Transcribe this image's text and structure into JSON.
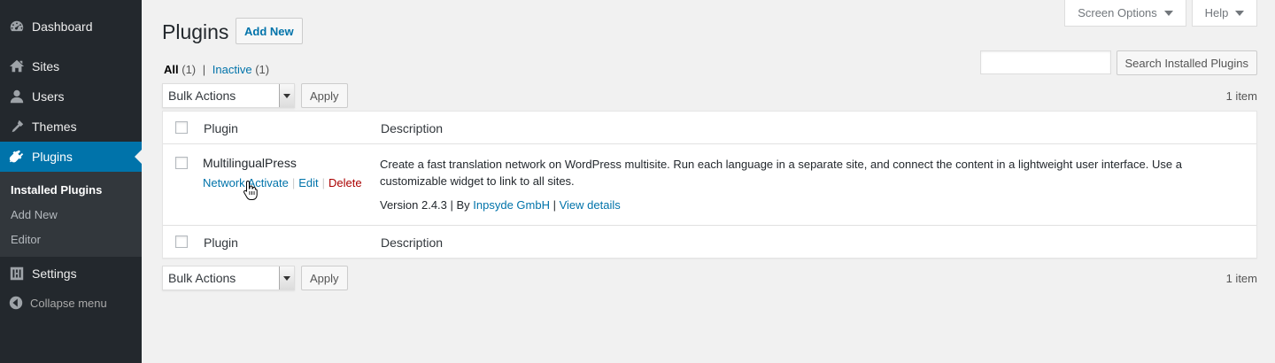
{
  "sidebar": {
    "items": [
      {
        "label": "Dashboard",
        "icon": "dashboard-icon"
      },
      {
        "label": "Sites",
        "icon": "sites-icon"
      },
      {
        "label": "Users",
        "icon": "users-icon"
      },
      {
        "label": "Themes",
        "icon": "themes-icon"
      },
      {
        "label": "Plugins",
        "icon": "plugins-icon"
      },
      {
        "label": "Settings",
        "icon": "settings-icon"
      }
    ],
    "submenu": [
      "Installed Plugins",
      "Add New",
      "Editor"
    ],
    "collapse_label": "Collapse menu"
  },
  "screen_meta": {
    "screen_options": "Screen Options",
    "help": "Help"
  },
  "header": {
    "title": "Plugins",
    "add_new": "Add New"
  },
  "filters": {
    "all_label": "All",
    "all_count": "(1)",
    "separator": "|",
    "inactive_label": "Inactive",
    "inactive_count": "(1)"
  },
  "search": {
    "value": "",
    "button_label": "Search Installed Plugins"
  },
  "tablenav": {
    "bulk_actions": "Bulk Actions",
    "apply": "Apply",
    "item_count": "1 item"
  },
  "table": {
    "columns": {
      "plugin": "Plugin",
      "description": "Description"
    },
    "rows": [
      {
        "name": "MultilingualPress",
        "actions": {
          "network_activate": "Network Activate",
          "edit": "Edit",
          "delete": "Delete",
          "sep": "|"
        },
        "description": "Create a fast translation network on WordPress multisite. Run each language in a separate site, and connect the content in a lightweight user interface. Use a customizable widget to link to all sites.",
        "version_prefix": "Version 2.4.3 | By ",
        "author": "Inpsyde GmbH",
        "version_sep": " | ",
        "view_details": "View details"
      }
    ]
  },
  "colors": {
    "sidebar_bg": "#23282d",
    "accent": "#0073aa",
    "delete": "#aa0000",
    "page_bg": "#f1f1f1"
  }
}
